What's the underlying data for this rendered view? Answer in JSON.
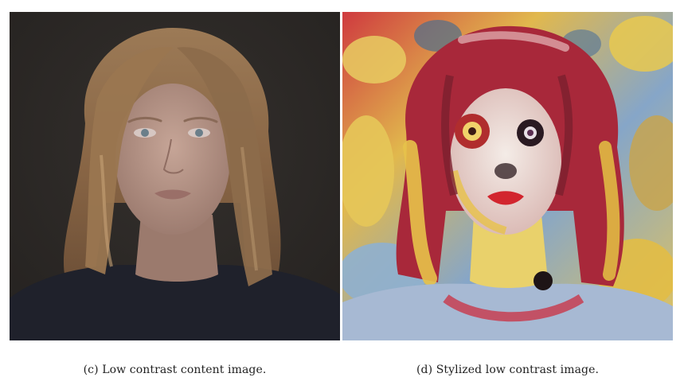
{
  "figure": {
    "panels": [
      {
        "id": "c",
        "caption": "(c) Low contrast content image.",
        "image": {
          "subject": "woman-portrait-photo",
          "palette": {
            "background": "#2b2725",
            "skin": "#b69488",
            "hair": "#8a6a4a",
            "hair_highlight": "#c7a176",
            "shirt": "#20222c",
            "eyes": "#6b7f8a",
            "lips": "#9a6f68"
          }
        }
      },
      {
        "id": "d",
        "caption": "(d) Stylized low contrast image.",
        "image": {
          "subject": "stylized-woman-portrait",
          "palette": {
            "background": "#d9c27a",
            "skin": "#eddcd5",
            "hair_red": "#b3283a",
            "hair_yellow": "#e7c24a",
            "blue": "#7fa2c6",
            "dark": "#2b1a1e",
            "lips": "#d2252e",
            "shirt": "#a7b9d3"
          }
        }
      }
    ]
  }
}
